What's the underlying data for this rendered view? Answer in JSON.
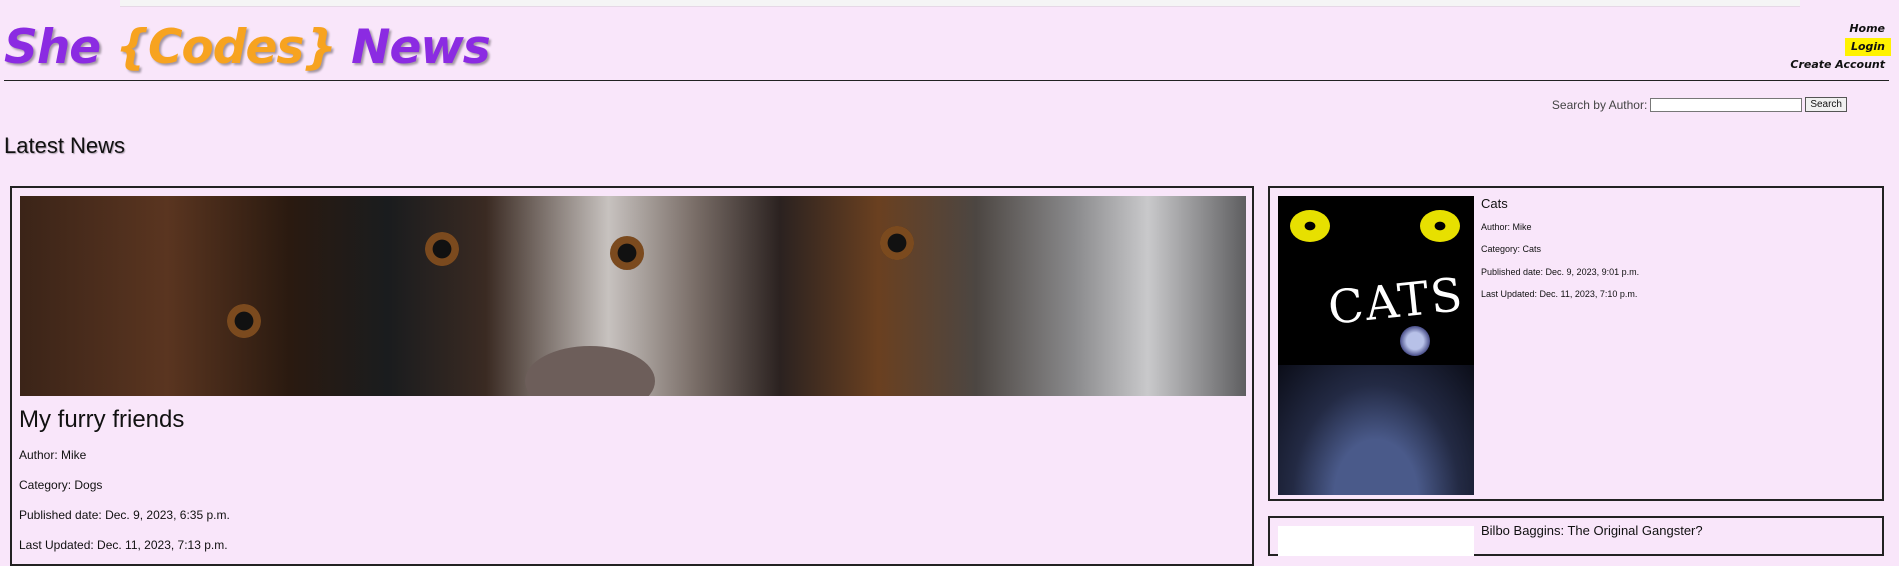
{
  "brand": {
    "she": "She",
    "codes": "{Codes}",
    "news": "News"
  },
  "nav": {
    "home": "Home",
    "login": "Login",
    "create_account": "Create Account"
  },
  "search": {
    "label": "Search by Author:",
    "button": "Search",
    "value": ""
  },
  "page": {
    "heading": "Latest News"
  },
  "featured": {
    "title": "My furry friends",
    "author": "Author: Mike",
    "category": "Category: Dogs",
    "published": "Published date: Dec. 9, 2023, 6:35 p.m.",
    "updated": "Last Updated: Dec. 11, 2023, 7:13 p.m."
  },
  "side": [
    {
      "title": "Cats",
      "image_text": "CATS",
      "author": "Author: Mike",
      "category": "Category: Cats",
      "published": "Published date: Dec. 9, 2023, 9:01 p.m.",
      "updated": "Last Updated: Dec. 11, 2023, 7:10 p.m."
    },
    {
      "title": "Bilbo Baggins: The Original Gangster?"
    }
  ],
  "colors": {
    "background": "#f9e6fa",
    "brand_purple": "#8b2be2",
    "brand_orange": "#f7a320",
    "login_highlight": "#fff200"
  }
}
